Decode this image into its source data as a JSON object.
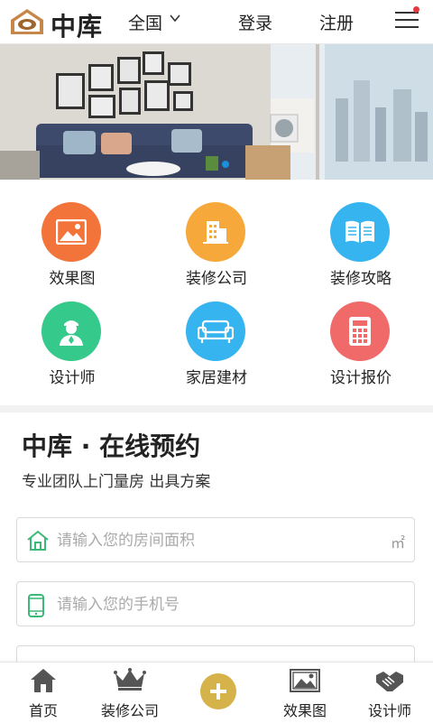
{
  "header": {
    "logo_text": "中库",
    "city": "全国",
    "login": "登录",
    "register": "注册"
  },
  "nav_items": [
    {
      "label": "效果图",
      "color": "#f2743b",
      "icon": "picture-icon"
    },
    {
      "label": "装修公司",
      "color": "#f6a83a",
      "icon": "building-icon"
    },
    {
      "label": "装修攻略",
      "color": "#36b4f0",
      "icon": "book-icon"
    },
    {
      "label": "设计师",
      "color": "#35c98c",
      "icon": "person-icon"
    },
    {
      "label": "家居建材",
      "color": "#36b4f0",
      "icon": "sofa-icon"
    },
    {
      "label": "设计报价",
      "color": "#f06a6a",
      "icon": "calculator-icon"
    }
  ],
  "booking": {
    "title": "中库 · 在线预约",
    "subtitle": "专业团队上门量房 出具方案",
    "area_placeholder": "请输入您的房间面积",
    "area_unit": "㎡",
    "phone_placeholder": "请输入您的手机号"
  },
  "bottom_nav": {
    "home": "首页",
    "company": "装修公司",
    "gallery": "效果图",
    "designer": "设计师",
    "accent": "#d6b24a"
  }
}
